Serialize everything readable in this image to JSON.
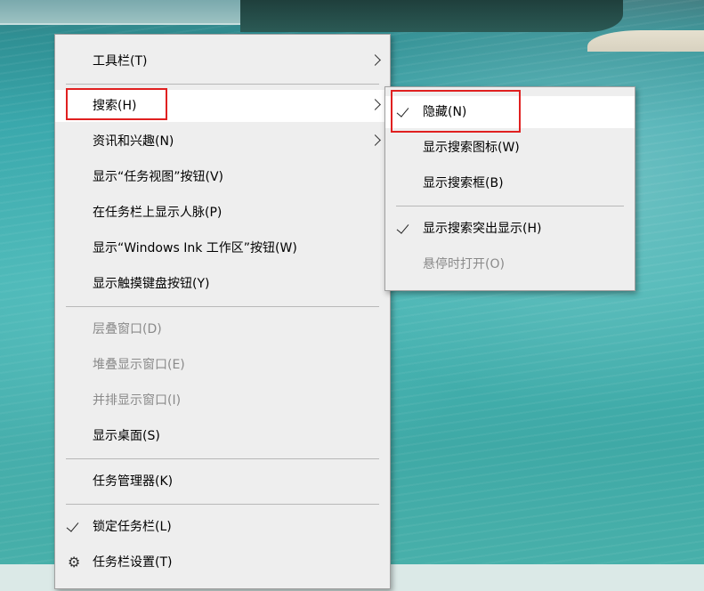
{
  "context_menu": {
    "items": [
      {
        "label": "工具栏(T)"
      },
      {
        "label": "搜索(H)"
      },
      {
        "label": "资讯和兴趣(N)"
      },
      {
        "label": "显示“任务视图”按钮(V)"
      },
      {
        "label": "在任务栏上显示人脉(P)"
      },
      {
        "label": "显示“Windows Ink 工作区”按钮(W)"
      },
      {
        "label": "显示触摸键盘按钮(Y)"
      },
      {
        "label": "层叠窗口(D)"
      },
      {
        "label": "堆叠显示窗口(E)"
      },
      {
        "label": "并排显示窗口(I)"
      },
      {
        "label": "显示桌面(S)"
      },
      {
        "label": "任务管理器(K)"
      },
      {
        "label": "锁定任务栏(L)"
      },
      {
        "label": "任务栏设置(T)"
      }
    ]
  },
  "search_submenu": {
    "items": [
      {
        "label": "隐藏(N)"
      },
      {
        "label": "显示搜索图标(W)"
      },
      {
        "label": "显示搜索框(B)"
      },
      {
        "label": "显示搜索突出显示(H)"
      },
      {
        "label": "悬停时打开(O)"
      }
    ]
  },
  "icons": {
    "submenu_arrow": "chevron-right-icon",
    "check": "checkmark-icon",
    "settings": "gear-icon"
  },
  "colors": {
    "menu_bg": "#eeeeee",
    "hover_bg": "#ffffff",
    "highlight_box": "#e02020",
    "disabled_text": "#8a8a8a"
  }
}
